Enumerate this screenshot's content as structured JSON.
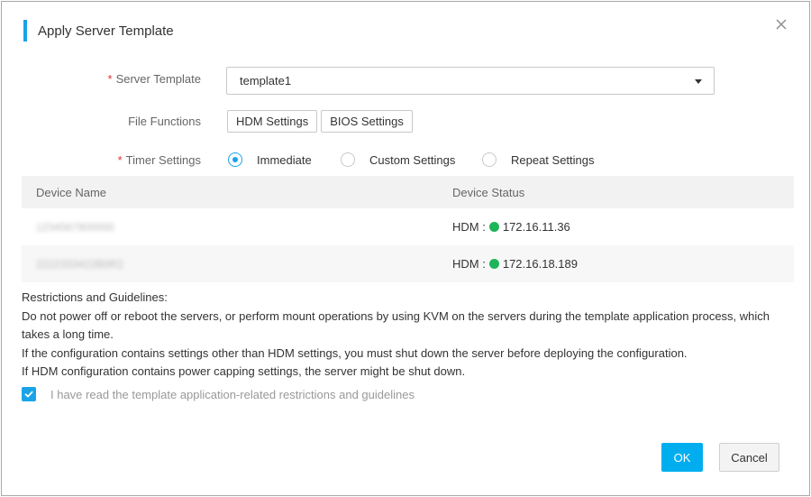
{
  "dialog": {
    "title": "Apply Server Template",
    "close_icon": "close-icon"
  },
  "form": {
    "server_template": {
      "required_mark": "*",
      "label": "Server Template",
      "value": "template1"
    },
    "file_functions": {
      "label": "File Functions",
      "buttons": [
        "HDM Settings",
        "BIOS Settings"
      ]
    },
    "timer_settings": {
      "required_mark": "*",
      "label": "Timer Settings",
      "options": [
        {
          "label": "Immediate",
          "checked": true
        },
        {
          "label": "Custom Settings",
          "checked": false
        },
        {
          "label": "Repeat Settings",
          "checked": false
        }
      ]
    }
  },
  "table": {
    "headers": [
      "Device Name",
      "Device Status"
    ],
    "rows": [
      {
        "device_name": "1234567800000",
        "status_prefix": "HDM :",
        "ip": "172.16.11.36",
        "status_color": "#1fb45a"
      },
      {
        "device_name": "2222333422B0R2",
        "status_prefix": "HDM :",
        "ip": "172.16.18.189",
        "status_color": "#1fb45a"
      }
    ]
  },
  "guidelines": {
    "title": "Restrictions and Guidelines:",
    "lines": [
      "Do not power off or reboot the servers, or perform mount operations by using KVM on the servers during the template application process, which takes a long time.",
      "If the configuration contains settings other than HDM settings, you must shut down the server before deploying the configuration.",
      "If HDM configuration contains power capping settings, the server might be shut down."
    ]
  },
  "confirm": {
    "checked": true,
    "text": "I have read the template application-related restrictions and guidelines"
  },
  "actions": {
    "ok_label": "OK",
    "cancel_label": "Cancel"
  },
  "colors": {
    "accent": "#1aa3e8",
    "ok_button": "#00aef0",
    "required": "#e03030",
    "status_online": "#1fb45a"
  }
}
